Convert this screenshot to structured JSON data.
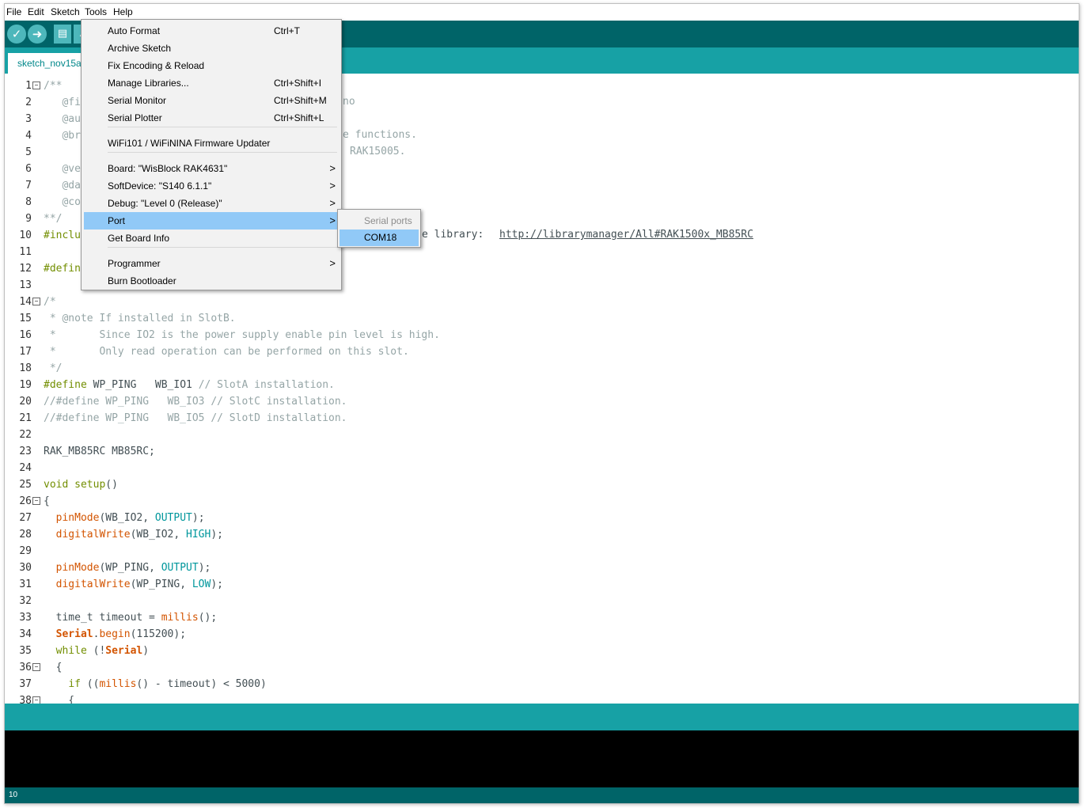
{
  "menubar": [
    "File",
    "Edit",
    "Sketch",
    "Tools",
    "Help"
  ],
  "tab": "sketch_nov15a",
  "tools_menu": {
    "items": [
      {
        "label": "Auto Format",
        "shortcut": "Ctrl+T"
      },
      {
        "label": "Archive Sketch",
        "shortcut": ""
      },
      {
        "label": "Fix Encoding & Reload",
        "shortcut": ""
      },
      {
        "label": "Manage Libraries...",
        "shortcut": "Ctrl+Shift+I"
      },
      {
        "label": "Serial Monitor",
        "shortcut": "Ctrl+Shift+M"
      },
      {
        "label": "Serial Plotter",
        "shortcut": "Ctrl+Shift+L"
      },
      {
        "label": "WiFi101 / WiFiNINA Firmware Updater",
        "shortcut": ""
      },
      {
        "label": "Board: \"WisBlock RAK4631\"",
        "shortcut": ""
      },
      {
        "label": "SoftDevice: \"S140 6.1.1\"",
        "shortcut": ""
      },
      {
        "label": "Debug: \"Level 0 (Release)\"",
        "shortcut": ""
      },
      {
        "label": "Port",
        "shortcut": ""
      },
      {
        "label": "Get Board Info",
        "shortcut": ""
      },
      {
        "label": "Programmer",
        "shortcut": ""
      },
      {
        "label": "Burn Bootloader",
        "shortcut": ""
      }
    ],
    "arrow": ">"
  },
  "port_submenu": {
    "header": "Serial ports",
    "selected": "COM18"
  },
  "code_lines": [
    {
      "n": "1",
      "t": "/**"
    },
    {
      "n": "2",
      "t": "   @fi"
    },
    {
      "n": "3",
      "t": "   @au"
    },
    {
      "n": "4",
      "t": "   @br"
    },
    {
      "n": "5",
      "t": ""
    },
    {
      "n": "6",
      "t": "   @ve"
    },
    {
      "n": "7",
      "t": "   @da"
    },
    {
      "n": "8",
      "t": "   @co"
    },
    {
      "n": "9",
      "t": "**/"
    },
    {
      "n": "10",
      "t": "#inclu"
    },
    {
      "n": "11",
      "t": ""
    },
    {
      "n": "12",
      "t": "#defin"
    },
    {
      "n": "13",
      "t": ""
    },
    {
      "n": "14",
      "t": "/*"
    },
    {
      "n": "15",
      "t": " * @note If installed in SlotB."
    },
    {
      "n": "16",
      "t": " *       Since IO2 is the power supply enable pin level is high."
    },
    {
      "n": "17",
      "t": " *       Only read operation can be performed on this slot."
    },
    {
      "n": "18",
      "t": " */"
    },
    {
      "n": "19",
      "t": "#define WP_PING   WB_IO1 // SlotA installation."
    },
    {
      "n": "20",
      "t": "//#define WP_PING   WB_IO3 // SlotC installation."
    },
    {
      "n": "21",
      "t": "//#define WP_PING   WB_IO5 // SlotD installation."
    },
    {
      "n": "22",
      "t": ""
    },
    {
      "n": "23",
      "t": "RAK_MB85RC MB85RC;"
    },
    {
      "n": "24",
      "t": ""
    },
    {
      "n": "25",
      "t": "void setup()"
    },
    {
      "n": "26",
      "t": "{"
    },
    {
      "n": "27",
      "t": "  pinMode(WB_IO2, OUTPUT);"
    },
    {
      "n": "28",
      "t": "  digitalWrite(WB_IO2, HIGH);"
    },
    {
      "n": "29",
      "t": ""
    },
    {
      "n": "30",
      "t": "  pinMode(WP_PING, OUTPUT);"
    },
    {
      "n": "31",
      "t": "  digitalWrite(WP_PING, LOW);"
    },
    {
      "n": "32",
      "t": ""
    },
    {
      "n": "33",
      "t": "  time_t timeout = millis();"
    },
    {
      "n": "34",
      "t": "  Serial.begin(115200);"
    },
    {
      "n": "35",
      "t": "  while (!Serial)"
    },
    {
      "n": "36",
      "t": "  {"
    },
    {
      "n": "37",
      "t": "    if ((millis() - timeout) < 5000)"
    },
    {
      "n": "38",
      "t": "    {"
    }
  ],
  "behind_menu_fragments": {
    "l2": "no",
    "l4": "e functions.",
    "l5": "RAK15005.",
    "l10": "e library: ",
    "l10_url": "http://librarymanager/All#RAK1500x_MB85RC"
  },
  "status_line": "10",
  "colors": {
    "toolbar": "#006468",
    "tabbar": "#17a1a5",
    "highlight": "#91c9f7"
  }
}
